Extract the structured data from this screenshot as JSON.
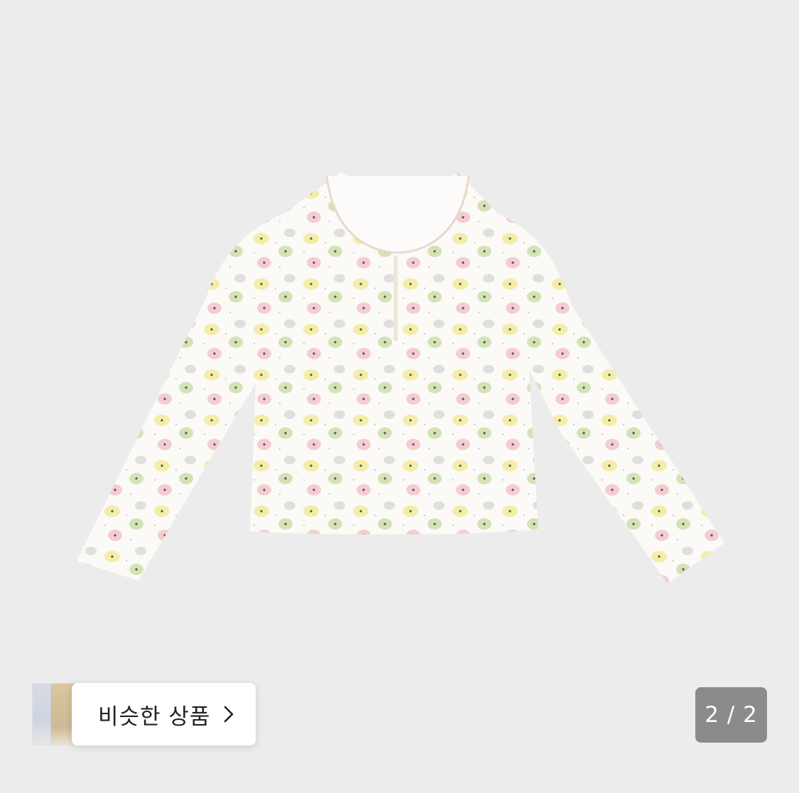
{
  "similar_products": {
    "label": "비슷한 상품"
  },
  "pagination": {
    "current": 2,
    "total": 2,
    "text": "2 / 2"
  },
  "colors": {
    "background": "#ececec",
    "counter_bg": "#8b8b8b",
    "button_bg": "#ffffff",
    "text": "#222222"
  },
  "icons": {
    "chevron": "chevron-right-icon"
  }
}
